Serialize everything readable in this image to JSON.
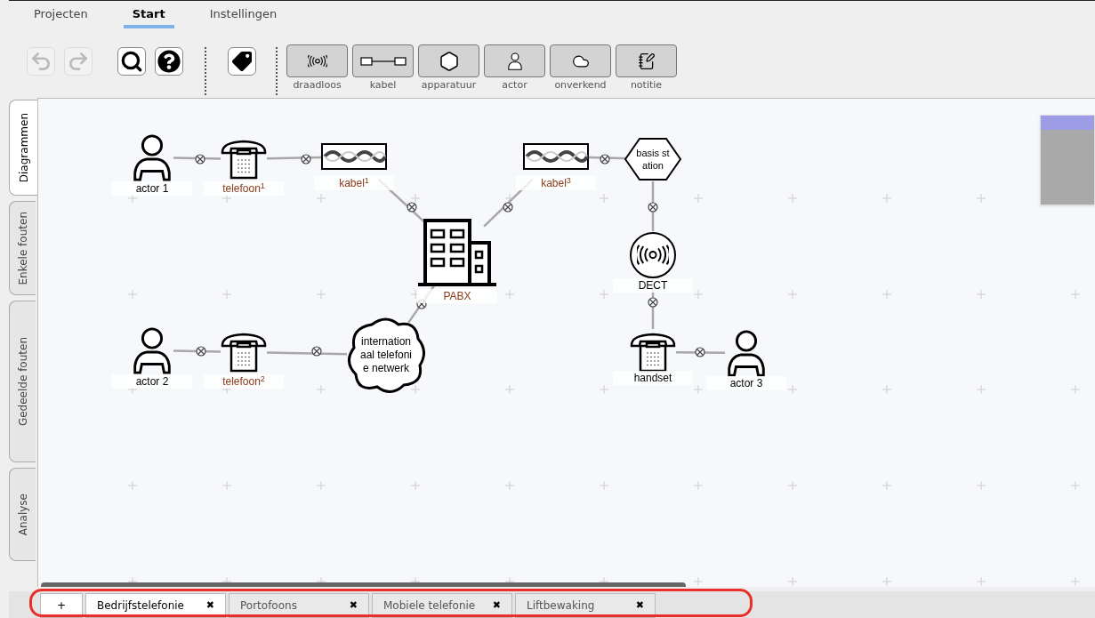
{
  "menu_tabs": [
    {
      "label": "Projecten",
      "selected": false
    },
    {
      "label": "Start",
      "selected": true
    },
    {
      "label": "Instellingen",
      "selected": false
    }
  ],
  "toolbar": {
    "undo": {
      "disabled": true
    },
    "redo": {
      "disabled": true
    },
    "tools": [
      {
        "kind": "wireless",
        "label": "draadloos"
      },
      {
        "kind": "cable",
        "label": "kabel"
      },
      {
        "kind": "device",
        "label": "apparatuur"
      },
      {
        "kind": "actor",
        "label": "actor"
      },
      {
        "kind": "unknown",
        "label": "onverkend"
      },
      {
        "kind": "note",
        "label": "notitie"
      }
    ]
  },
  "side_tabs": [
    {
      "label": "Diagrammen",
      "selected": true
    },
    {
      "label": "Enkele fouten",
      "selected": false
    },
    {
      "label": "Gedeelde fouten",
      "selected": false
    },
    {
      "label": "Analyse",
      "selected": false
    }
  ],
  "diagram": {
    "nodes": [
      {
        "kind": "actor",
        "label": "actor 1",
        "color": "#000000"
      },
      {
        "kind": "phone",
        "label": "telefoon$^{1}$",
        "color": "#8b3a1a"
      },
      {
        "kind": "cable",
        "label": "kabel$^{1}$",
        "color": "#8b3a1a"
      },
      {
        "kind": "cable",
        "label": "kabel$^{3}$",
        "color": "#8b3a1a"
      },
      {
        "kind": "hexagon",
        "text": "basis st\nation"
      },
      {
        "kind": "building",
        "label": "PABX",
        "color": "#8b3a1a"
      },
      {
        "kind": "wireless",
        "label": "DECT",
        "color": "#000000"
      },
      {
        "kind": "actor",
        "label": "actor 2",
        "color": "#000000"
      },
      {
        "kind": "phone",
        "label": "telefoon$^{2}$",
        "color": "#8b3a1a"
      },
      {
        "kind": "cloud",
        "text": "internation\naal telefoni\ne netwerk"
      },
      {
        "kind": "phone",
        "label": "handset",
        "color": "#000000"
      },
      {
        "kind": "actor",
        "label": "actor 3",
        "color": "#000000"
      }
    ]
  },
  "document_tabs": {
    "add": "+",
    "tabs": [
      {
        "label": "Bedrijfstelefonie",
        "close": "✖",
        "selected": true
      },
      {
        "label": "Portofoons",
        "close": "✖",
        "selected": false
      },
      {
        "label": "Mobiele telefonie",
        "close": "✖",
        "selected": false
      },
      {
        "label": "Liftbewaking",
        "close": "✖",
        "selected": false
      }
    ]
  }
}
